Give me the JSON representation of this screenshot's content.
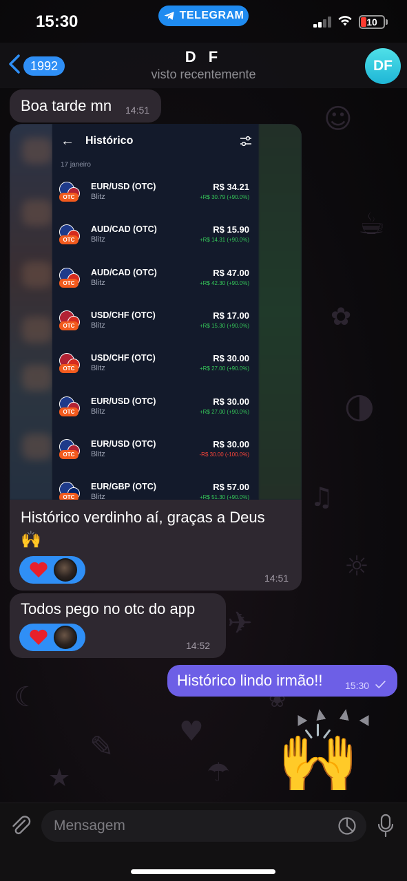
{
  "status_bar": {
    "time": "15:30",
    "app_pill": "TELEGRAM",
    "battery": "10"
  },
  "header": {
    "back_count": "1992",
    "title": "D F",
    "subtitle": "visto recentemente",
    "avatar_initials": "DF"
  },
  "messages": [
    {
      "dir": "in",
      "text": "Boa tarde mn",
      "time": "14:51"
    },
    {
      "dir": "in",
      "type": "photo_caption",
      "text": "Histórico verdinho aí, graças a Deus",
      "emoji": "🙌",
      "time": "14:51",
      "reaction": "❤️"
    },
    {
      "dir": "in",
      "text": "Todos pego no otc do app",
      "time": "14:52",
      "reaction": "❤️"
    },
    {
      "dir": "out",
      "text": "Histórico lindo irmão!!",
      "time": "15:30",
      "status": "sent"
    }
  ],
  "sticker": "🙌",
  "embedded_app": {
    "title": "Histórico",
    "date": "17 janeiro",
    "trades": [
      {
        "pair": "EUR/USD (OTC)",
        "mode": "Blitz",
        "amount": "R$ 34.21",
        "result": "+R$ 30.79 (+90.0%)",
        "win": true,
        "flags": [
          "#1e3a8a",
          "#b22234"
        ]
      },
      {
        "pair": "AUD/CAD (OTC)",
        "mode": "Blitz",
        "amount": "R$ 15.90",
        "result": "+R$ 14.31 (+90.0%)",
        "win": true,
        "flags": [
          "#1e3a8a",
          "#d52b1e"
        ]
      },
      {
        "pair": "AUD/CAD (OTC)",
        "mode": "Blitz",
        "amount": "R$ 47.00",
        "result": "+R$ 42.30 (+90.0%)",
        "win": true,
        "flags": [
          "#1e3a8a",
          "#d52b1e"
        ]
      },
      {
        "pair": "USD/CHF (OTC)",
        "mode": "Blitz",
        "amount": "R$ 17.00",
        "result": "+R$ 15.30 (+90.0%)",
        "win": true,
        "flags": [
          "#b22234",
          "#d52b1e"
        ]
      },
      {
        "pair": "USD/CHF (OTC)",
        "mode": "Blitz",
        "amount": "R$ 30.00",
        "result": "+R$ 27.00 (+90.0%)",
        "win": true,
        "flags": [
          "#b22234",
          "#d52b1e"
        ]
      },
      {
        "pair": "EUR/USD (OTC)",
        "mode": "Blitz",
        "amount": "R$ 30.00",
        "result": "+R$ 27.00 (+90.0%)",
        "win": true,
        "flags": [
          "#1e3a8a",
          "#b22234"
        ]
      },
      {
        "pair": "EUR/USD (OTC)",
        "mode": "Blitz",
        "amount": "R$ 30.00",
        "result": "-R$ 30.00 (-100.0%)",
        "win": false,
        "flags": [
          "#1e3a8a",
          "#b22234"
        ]
      },
      {
        "pair": "EUR/GBP (OTC)",
        "mode": "Blitz",
        "amount": "R$ 57.00",
        "result": "+R$ 51.30 (+90.0%)",
        "win": true,
        "flags": [
          "#1e3a8a",
          "#012169"
        ]
      }
    ],
    "otc_label": "OTC"
  },
  "input": {
    "placeholder": "Mensagem"
  },
  "colors": {
    "accent": "#2f8ff6",
    "outgoing": "#6d5fe6",
    "incoming": "#2e2830",
    "win": "#35c759",
    "loss": "#ff453a"
  }
}
